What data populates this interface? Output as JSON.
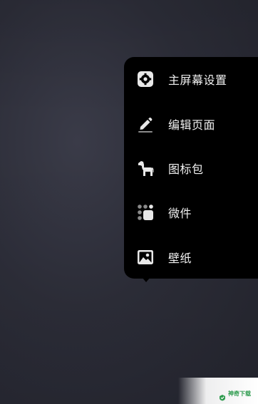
{
  "menu": {
    "items": [
      {
        "label": "主屏幕设置",
        "icon": "gear-icon"
      },
      {
        "label": "编辑页面",
        "icon": "pencil-icon"
      },
      {
        "label": "图标包",
        "icon": "horse-icon"
      },
      {
        "label": "微件",
        "icon": "widgets-icon"
      },
      {
        "label": "壁纸",
        "icon": "wallpaper-icon"
      }
    ]
  },
  "watermark": {
    "text": "神奇下载"
  },
  "colors": {
    "menu_background": "#000000",
    "menu_text": "#f2f2f2",
    "icon": "#e8e8e8",
    "watermark_text": "#2e9b4e"
  }
}
